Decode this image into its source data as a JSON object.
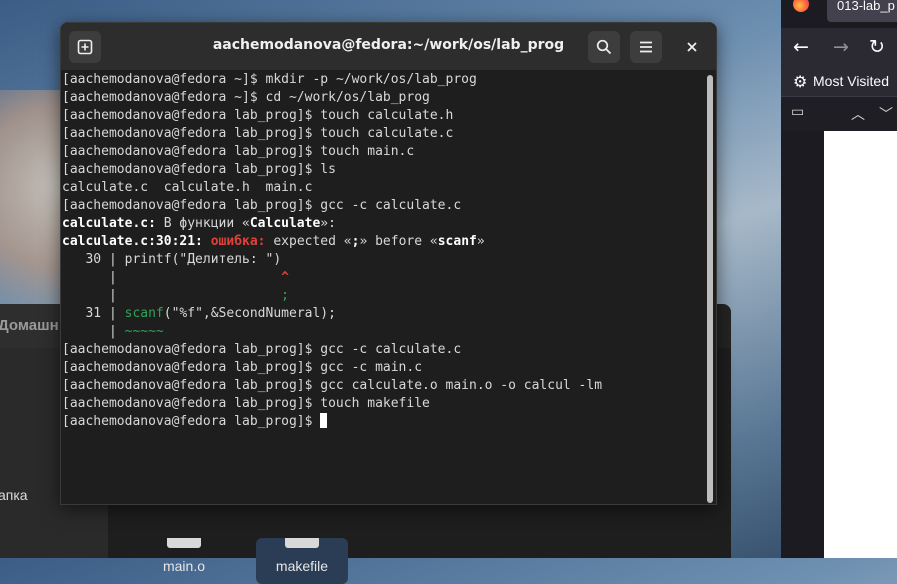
{
  "file_manager": {
    "header_label": "Домашн",
    "sidebar_item": "апка",
    "files": [
      {
        "name": "main.o",
        "selected": false
      },
      {
        "name": "makefile",
        "selected": true
      }
    ]
  },
  "browser": {
    "tab_title": "013-lab_p",
    "bookmarks_label": "Most Visited",
    "icons": {
      "back": "arrow-left-icon",
      "forward": "arrow-right-icon",
      "reload": "reload-icon",
      "gear": "gear-icon"
    }
  },
  "terminal": {
    "title": "aachemodanova@fedora:~/work/os/lab_prog",
    "buttons": {
      "new_tab": "new-tab-icon",
      "search": "search-icon",
      "menu": "hamburger-menu-icon",
      "close": "close-icon"
    },
    "lines": [
      {
        "prompt": "[aachemodanova@fedora ~]$ ",
        "cmd": "mkdir -p ~/work/os/lab_prog"
      },
      {
        "prompt": "[aachemodanova@fedora ~]$ ",
        "cmd": "cd ~/work/os/lab_prog"
      },
      {
        "prompt": "[aachemodanova@fedora lab_prog]$ ",
        "cmd": "touch calculate.h"
      },
      {
        "prompt": "[aachemodanova@fedora lab_prog]$ ",
        "cmd": "touch calculate.c"
      },
      {
        "prompt": "[aachemodanova@fedora lab_prog]$ ",
        "cmd": "touch main.c"
      },
      {
        "prompt": "[aachemodanova@fedora lab_prog]$ ",
        "cmd": "ls"
      },
      {
        "text": "calculate.c  calculate.h  main.c"
      },
      {
        "prompt": "[aachemodanova@fedora lab_prog]$ ",
        "cmd": "gcc -c calculate.c"
      },
      {
        "diag_file": "calculate.c:",
        "diag_text": " В функции «",
        "diag_func": "Calculate",
        "diag_end": "»:"
      },
      {
        "loc": "calculate.c:30:21:",
        "err": " ошибка:",
        "msg1": " expected «",
        "tok1": ";",
        "msg2": "» before «",
        "tok2": "scanf",
        "msg3": "»"
      },
      {
        "text": "   30 | printf(\"Делитель: \")"
      },
      {
        "gutter": "      | ",
        "mark": "                    ^"
      },
      {
        "gutter": "      | ",
        "mark": "                    ;"
      },
      {
        "gutter": "   31 | ",
        "code_kw": "scanf",
        "code_rest": "(\"%f\",&SecondNumeral);"
      },
      {
        "gutter": "      | ",
        "mark": "~~~~~"
      },
      {
        "prompt": "[aachemodanova@fedora lab_prog]$ ",
        "cmd": "gcc -c calculate.c"
      },
      {
        "prompt": "[aachemodanova@fedora lab_prog]$ ",
        "cmd": "gcc -c main.c"
      },
      {
        "prompt": "[aachemodanova@fedora lab_prog]$ ",
        "cmd": "gcc calculate.o main.o -o calcul -lm"
      },
      {
        "prompt": "[aachemodanova@fedora lab_prog]$ ",
        "cmd": "touch makefile"
      },
      {
        "prompt": "[aachemodanova@fedora lab_prog]$ ",
        "cmd": ""
      }
    ]
  }
}
